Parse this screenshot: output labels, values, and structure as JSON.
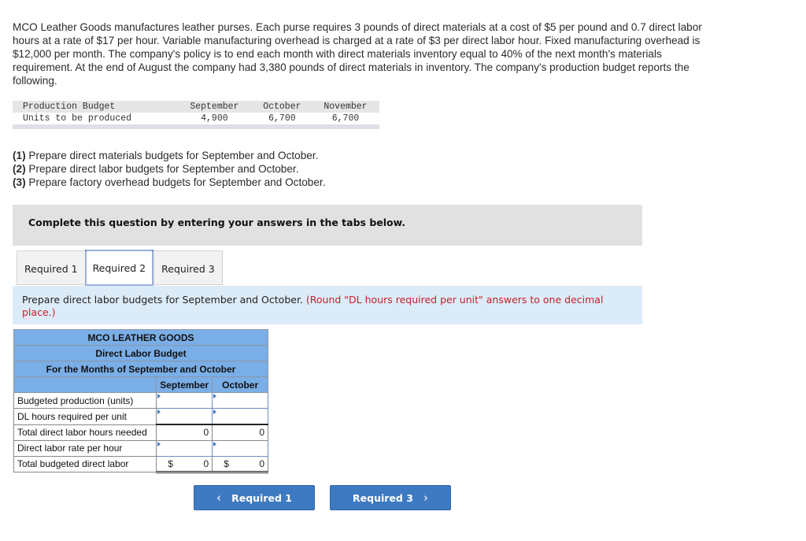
{
  "intro_text": "MCO Leather Goods manufactures leather purses. Each purse requires 3 pounds of direct materials at a cost of $5 per pound and 0.7 direct labor hours at a rate of $17 per hour. Variable manufacturing overhead is charged at a rate of $3 per direct labor hour. Fixed manufacturing overhead is $12,000 per month. The company's policy is to end each month with direct materials inventory equal to 40% of the next month's materials requirement. At the end of August the company had 3,380 pounds of direct materials in inventory. The company's production budget reports the following.",
  "production_budget": {
    "header": [
      "Production Budget",
      "September",
      "October",
      "November"
    ],
    "row_label": "Units to be produced",
    "values": [
      "4,900",
      "6,700",
      "6,700"
    ]
  },
  "requirements": [
    {
      "num": "(1)",
      "text": " Prepare direct materials budgets for September and October."
    },
    {
      "num": "(2)",
      "text": " Prepare direct labor budgets for September and October."
    },
    {
      "num": "(3)",
      "text": " Prepare factory overhead budgets for September and October."
    }
  ],
  "complete_banner": "Complete this question by entering your answers in the tabs below.",
  "tabs": [
    {
      "label": "Required 1",
      "active": false
    },
    {
      "label": "Required 2",
      "active": true
    },
    {
      "label": "Required 3",
      "active": false
    }
  ],
  "instruction": {
    "text": "Prepare direct labor budgets for September and October. ",
    "note": "(Round \"DL hours required per unit\" answers to one decimal place.)"
  },
  "budget": {
    "company": "MCO LEATHER GOODS",
    "title": "Direct Labor Budget",
    "period": "For the Months of September and October",
    "columns": [
      "September",
      "October"
    ],
    "rows": [
      {
        "label": "Budgeted production (units)",
        "type": "input",
        "values": [
          "",
          ""
        ]
      },
      {
        "label": "DL hours required per unit",
        "type": "input",
        "values": [
          "",
          ""
        ]
      },
      {
        "label": "Total direct labor hours needed",
        "type": "calc",
        "values": [
          "0",
          "0"
        ]
      },
      {
        "label": "Direct labor rate per hour",
        "type": "input",
        "values": [
          "",
          ""
        ]
      },
      {
        "label": "Total budgeted direct labor",
        "type": "total",
        "currency": "$",
        "values": [
          "0",
          "0"
        ]
      }
    ]
  },
  "nav": {
    "prev_label": "Required 1",
    "next_label": "Required 3",
    "prev_icon": "‹",
    "next_icon": "›"
  }
}
